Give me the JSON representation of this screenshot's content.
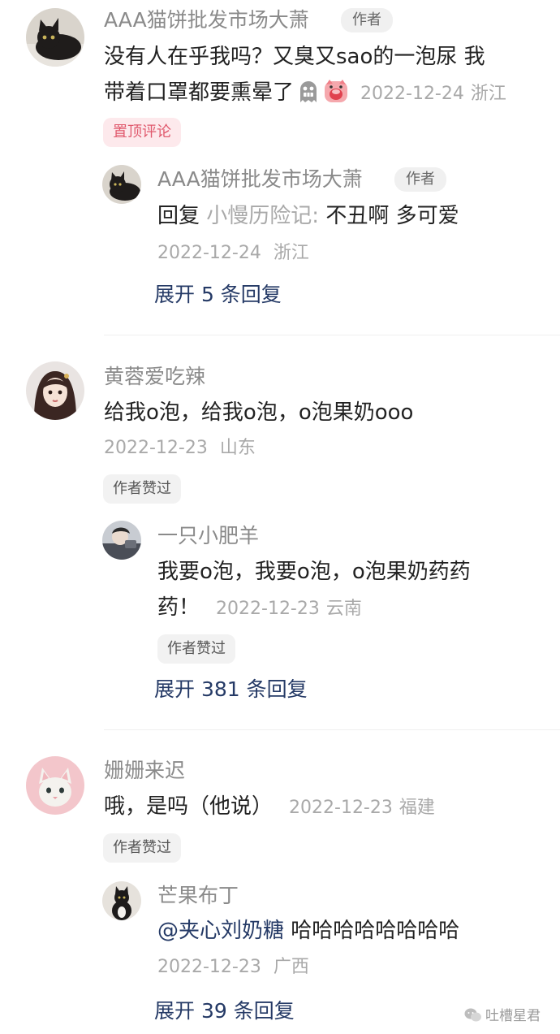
{
  "comments": [
    {
      "name": "AAA猫饼批发市场大萧",
      "author_tag": "作者",
      "text_line1": "没有人在乎我吗？又臭又sao的一泡尿 我",
      "text_line2": "带着口罩都要熏晕了",
      "time": "2022-12-24",
      "location": "浙江",
      "badge": "置顶评论",
      "reply": {
        "name": "AAA猫饼批发市场大萧",
        "author_tag": "作者",
        "prefix": "回复",
        "target": "小慢历险记:",
        "text": "不丑啊 多可爱",
        "time": "2022-12-24",
        "location": "浙江"
      },
      "expand": "展开 5 条回复"
    },
    {
      "name": "黄蓉爱吃辣",
      "text": "给我o泡，给我o泡，o泡果奶ooo",
      "time": "2022-12-23",
      "location": "山东",
      "badge": "作者赞过",
      "reply": {
        "name": "一只小肥羊",
        "text_line1": "我要o泡，我要o泡，o泡果奶药药",
        "text_line2": "药！",
        "time": "2022-12-23",
        "location": "云南",
        "badge": "作者赞过"
      },
      "expand": "展开 381 条回复"
    },
    {
      "name": "姗姗来迟",
      "text": "哦，是吗（他说）",
      "time": "2022-12-23",
      "location": "福建",
      "badge": "作者赞过",
      "reply": {
        "name": "芒果布丁",
        "mention": "@夹心刘奶糖",
        "text": " 哈哈哈哈哈哈哈哈",
        "time": "2022-12-23",
        "location": "广西"
      },
      "expand": "展开 39 条回复"
    }
  ],
  "watermark": "吐槽星君",
  "icons": {
    "emoji1": "grimacing-ghost-emoji",
    "emoji2": "screaming-pig-emoji",
    "watermark_icon": "wechat-icon"
  }
}
